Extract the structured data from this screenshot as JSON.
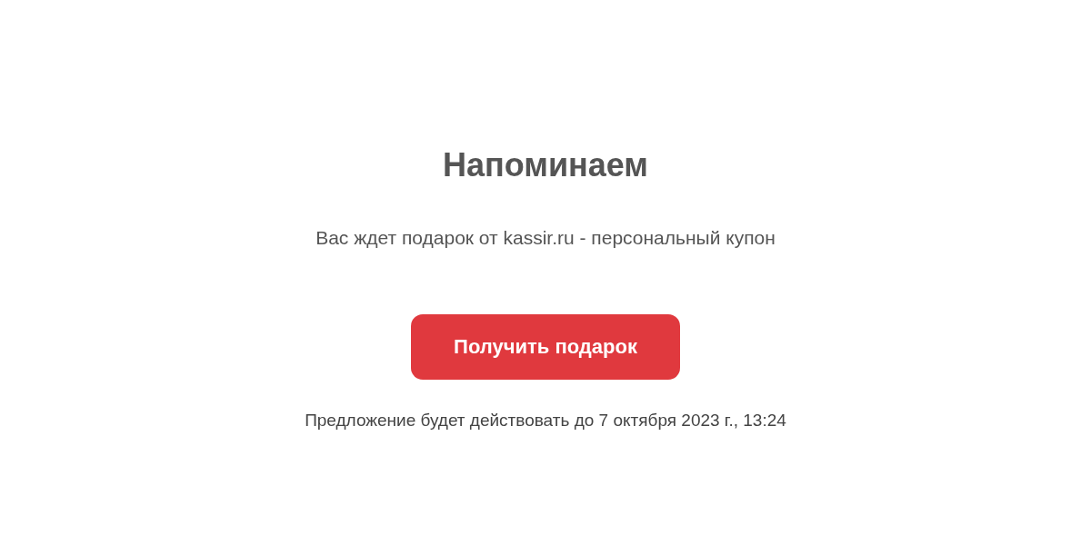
{
  "title": "Напоминаем",
  "message": "Вас ждет подарок от kassir.ru - персональный купон",
  "button": {
    "label": "Получить подарок"
  },
  "note": "Предложение будет действовать до 7 октября 2023 г., 13:24"
}
